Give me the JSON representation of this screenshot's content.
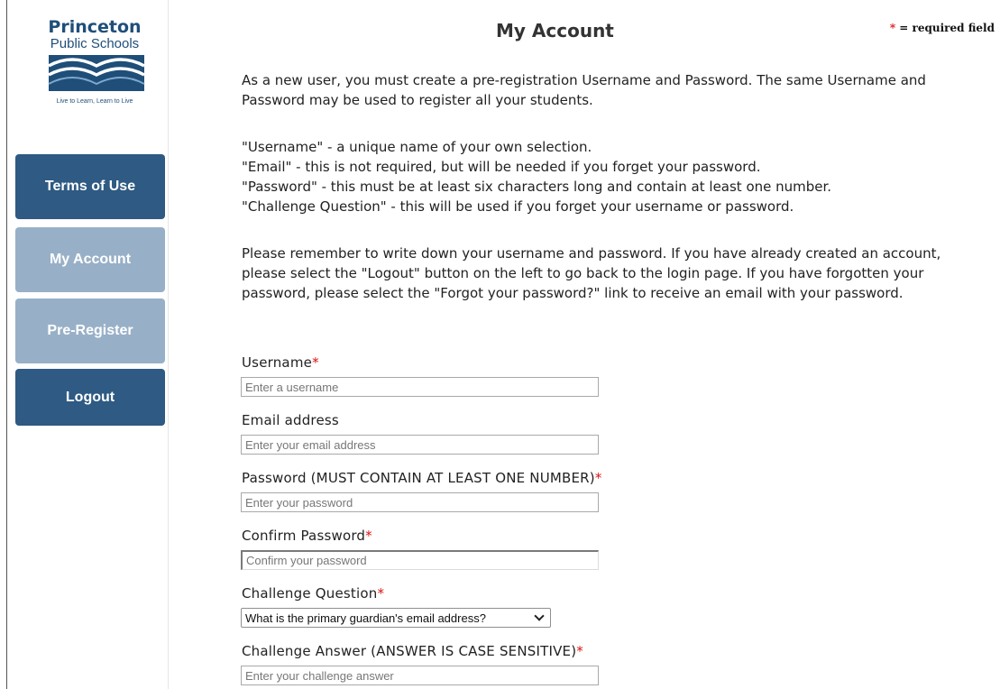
{
  "logo": {
    "title": "Princeton",
    "subtitle": "Public Schools",
    "tagline": "Live to Learn, Learn to Live",
    "color": "#1f4e79"
  },
  "nav": {
    "items": [
      {
        "label": "Terms of Use",
        "state": "default"
      },
      {
        "label": "My Account",
        "state": "active"
      },
      {
        "label": "Pre-Register",
        "state": "disabled"
      },
      {
        "label": "Logout",
        "state": "default"
      }
    ],
    "colors": {
      "dark": "#2e5a83",
      "light": "#98b0c7"
    }
  },
  "page": {
    "title": "My Account",
    "required_star": "*",
    "required_text": " = required field"
  },
  "intro": {
    "p1": "As a new user, you must create a pre-registration Username and Password. The same Username and Password may be used to register all your students.",
    "lines": [
      "\"Username\" - a unique name of your own selection.",
      "\"Email\" - this is not required, but will be needed if you forget your password.",
      "\"Password\" - this must be at least six characters long and contain at least one number.",
      "\"Challenge Question\" - this will be used if you forget your username or password."
    ],
    "p3": "Please remember to write down your username and password. If you have already created an account, please select the \"Logout\" button on the left to go back to the login page. If you have forgotten your password, please select the \"Forgot your password?\" link to receive an email with your password."
  },
  "form": {
    "username": {
      "label": "Username",
      "required": "*",
      "placeholder": "Enter a username",
      "value": ""
    },
    "email": {
      "label": "Email address",
      "placeholder": "Enter your email address",
      "value": ""
    },
    "password": {
      "label": "Password (MUST CONTAIN AT LEAST ONE NUMBER)",
      "required": "*",
      "placeholder": "Enter your password",
      "value": ""
    },
    "confirm": {
      "label": "Confirm Password",
      "required": "*",
      "placeholder": "Confirm your password",
      "value": ""
    },
    "question": {
      "label": "Challenge Question",
      "required": "*",
      "selected": "What is the primary guardian's email address?"
    },
    "answer": {
      "label": "Challenge Answer (ANSWER IS CASE SENSITIVE)",
      "required": "*",
      "placeholder": "Enter your challenge answer",
      "value": ""
    }
  },
  "colors": {
    "required_star": "#dd1111",
    "text": "#222222"
  }
}
